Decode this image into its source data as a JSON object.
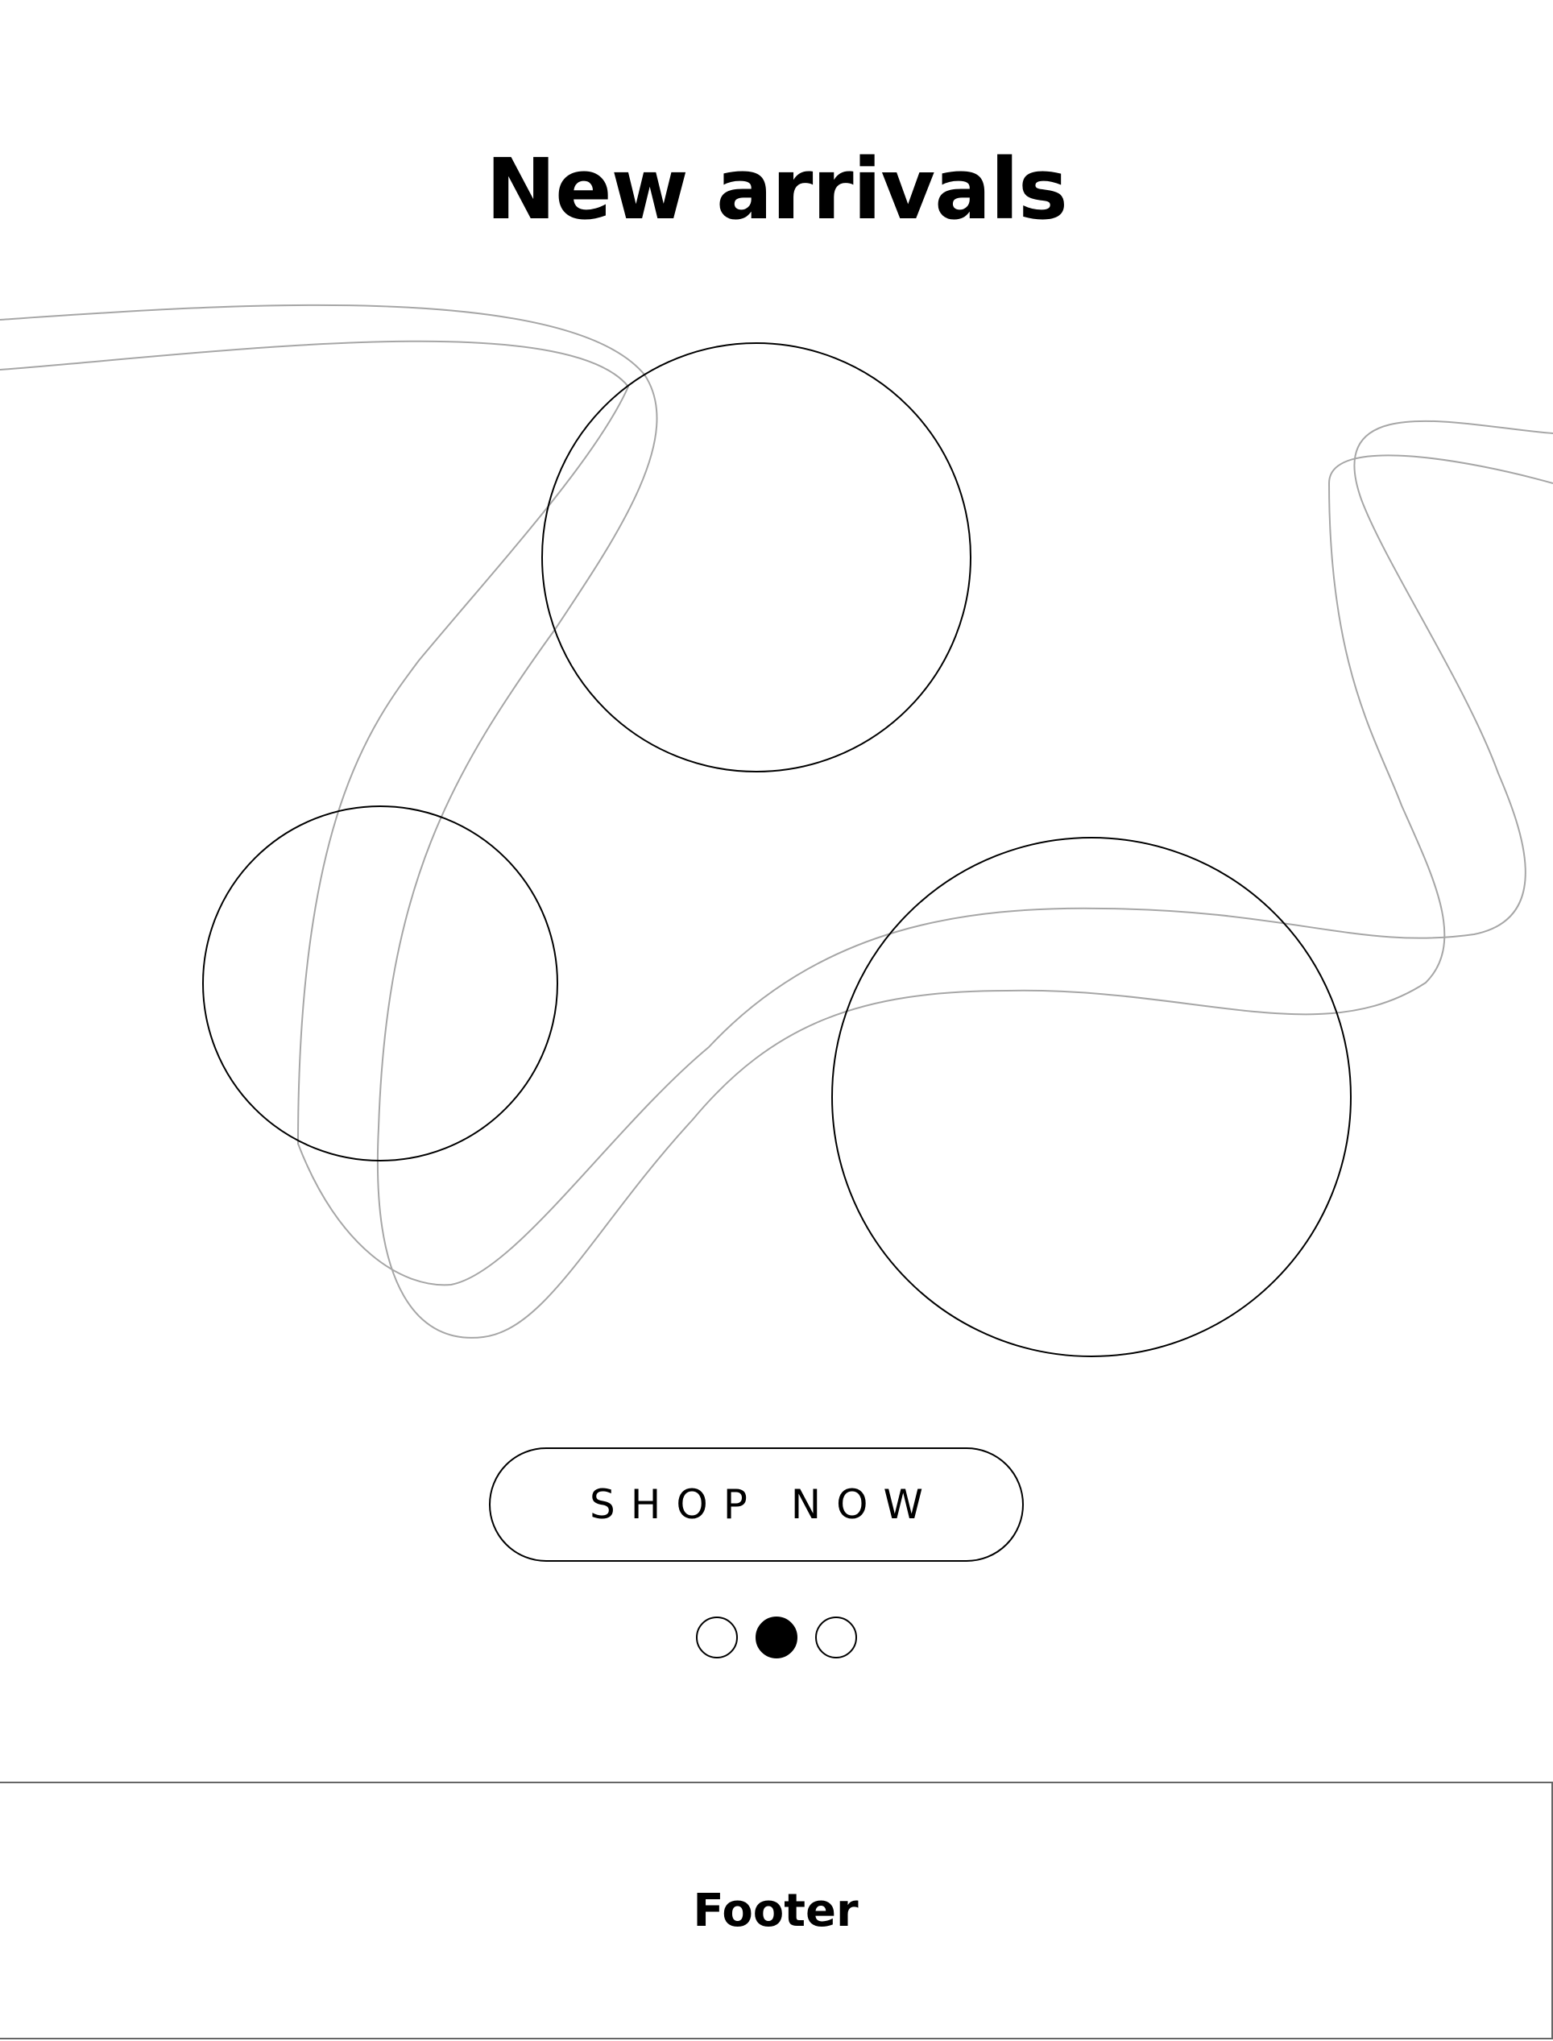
{
  "hero": {
    "title": "New arrivals"
  },
  "products": [
    {
      "name": "product-circle-top"
    },
    {
      "name": "product-circle-left"
    },
    {
      "name": "product-circle-right"
    }
  ],
  "cta": {
    "label": "SHOP NOW"
  },
  "carousel": {
    "total": 3,
    "active_index": 1
  },
  "footer": {
    "label": "Footer"
  },
  "colors": {
    "background": "#ffffff",
    "text": "#000000",
    "decor_line": "#a6a6a6",
    "footer_border": "#666666"
  }
}
